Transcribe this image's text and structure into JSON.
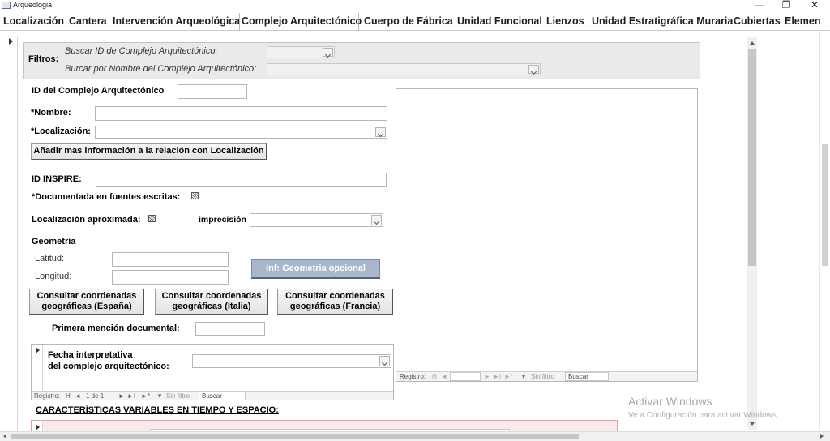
{
  "window": {
    "title": "Arqueologia",
    "minimize": "—",
    "restore": "❐",
    "close": "✕"
  },
  "tabs": [
    {
      "label": "Localización"
    },
    {
      "label": "Cantera"
    },
    {
      "label": "Intervención Arqueológica"
    },
    {
      "label": "Complejo Arquitectónico",
      "active": true
    },
    {
      "label": "Cuerpo de Fábrica"
    },
    {
      "label": "Unidad Funcional"
    },
    {
      "label": "Lienzos"
    },
    {
      "label": "Unidad Estratigráfica Muraria"
    },
    {
      "label": "Cubiertas"
    },
    {
      "label": "Elemen"
    }
  ],
  "filters": {
    "label": "Filtros:",
    "search_id_label": "Buscar ID de Complejo Arquitectónico:",
    "search_name_label": "Burcar por Nombre del Complejo Arquitectónico:",
    "search_id_value": "",
    "search_name_value": ""
  },
  "form": {
    "id_label": "ID del Complejo Arquitectónico",
    "id_value": "",
    "nombre_label": "*Nombre:",
    "nombre_value": "",
    "localizacion_label": "*Localización:",
    "localizacion_value": "",
    "add_info_button": "Añadir mas información a la relación con Localización",
    "inspire_label": "ID INSPIRE:",
    "inspire_value": "",
    "documentada_label": "*Documentada en fuentes escritas:",
    "loc_aprox_label": "Localización aproximada:",
    "imprecision_label": "imprecisión",
    "imprecision_value": "",
    "geometria_label": "Geometría",
    "latitud_label": "Latitud:",
    "latitud_value": "",
    "longitud_label": "Longitud:",
    "longitud_value": "",
    "geom_button": "Inf: Geometria opcional",
    "coord_es_line1": "Consultar coordenadas",
    "coord_es_line2": "geográficas (España)",
    "coord_it_line1": "Consultar coordenadas",
    "coord_it_line2": "geográficas (Italia)",
    "coord_fr_line1": "Consultar coordenadas",
    "coord_fr_line2": "geográficas (Francia)",
    "primera_label": "Primera mención documental:",
    "primera_value": ""
  },
  "fecha_subform": {
    "label_line1": "Fecha interpretativa",
    "label_line2": "del complejo arquitectónico:",
    "value": "",
    "nav": {
      "registro": "Registro:",
      "first": "H",
      "prev": "◄",
      "record": "1 de 1",
      "next": "►",
      "last": "►I",
      "new": "►*",
      "filter_icon": "▼",
      "filter": "Sin filtro",
      "search": "Buscar"
    }
  },
  "right_subform": {
    "nav": {
      "registro": "Registro:",
      "first": "H",
      "prev": "◄",
      "record": "",
      "next": "►",
      "last": "►I",
      "new": "►*",
      "filter_icon": "▼",
      "filter": "Sin filtro",
      "search": "Buscar"
    }
  },
  "caracteristicas_label": "CARACTERÍSTICAS VARIABLES EN TIEMPO Y ESPACIO:",
  "watermark": {
    "line1": "Activar Windows",
    "line2": "Ve a Configuración para activar Windows."
  }
}
